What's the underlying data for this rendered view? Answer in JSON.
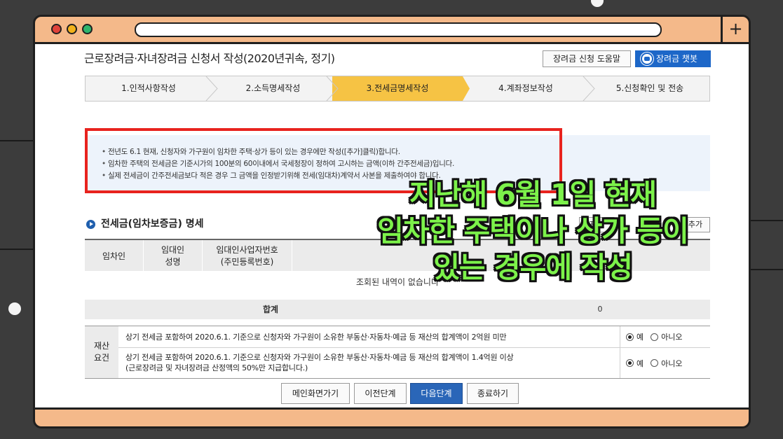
{
  "browser": {
    "new_tab_symbol": "+"
  },
  "page": {
    "title": "근로장려금·자녀장려금 신청서 작성(2020년귀속, 정기)",
    "help_button": "장려금 신청 도움말",
    "chatbot_button": "장려금 챗봇"
  },
  "steps": [
    {
      "label": "1.인적사항작성",
      "active": false
    },
    {
      "label": "2.소득명세작성",
      "active": false
    },
    {
      "label": "3.전세금명세작성",
      "active": true
    },
    {
      "label": "4.계좌정보작성",
      "active": false
    },
    {
      "label": "5.신청확인 및 전송",
      "active": false
    }
  ],
  "notice": [
    "전년도 6.1 현재, 신청자와 가구원이 임차한 주택·상가 등이 있는 경우에만 작성([추가]클릭)합니다.",
    "임차한 주택의 전세금은 기준시가의 100분의 60이내에서 국세청장이 정하여 고시하는 금액(이하 간주전세금)입니다.",
    "실제 전세금이 간주전세금보다 적은 경우 그 금액을 인정받기위해 전세(임대차)계약서 사본을 제출하여야 합니다."
  ],
  "section": {
    "title": "전세금(임차보증금) 명세",
    "btn_partial": "자료",
    "btn_add": "추가"
  },
  "table": {
    "headers": [
      "임차인",
      "임대인\n성명",
      "임대인사업자번호\n(주민등록번호)"
    ],
    "empty_message": "조회된 내역이 없습니다",
    "total_label": "합계",
    "total_value": "0"
  },
  "property": {
    "label": "재산\n요건",
    "rows": [
      {
        "text": "상기 전세금 포함하여 2020.6.1. 기준으로 신청자와 가구원이 소유한 부동산·자동차·예금 등 재산의 합계액이 2억원 미만",
        "selected": "yes"
      },
      {
        "text": "상기 전세금 포함하여 2020.6.1. 기준으로 신청자와 가구원이 소유한 부동산·자동차·예금 등 재산의 합계액이 1.4억원 이상\n(근로장려금 및 자녀장려금 산정액의 50%만 지급합니다.)",
        "selected": "yes"
      }
    ],
    "yes_label": "예",
    "no_label": "아니오"
  },
  "buttons": {
    "main": "메인화면가기",
    "prev": "이전단계",
    "next": "다음단계",
    "end": "종료하기"
  },
  "overlay": {
    "line1": "지난해 6월 1일 현재",
    "line2": "임차한 주택이나 상가 등이",
    "line3": "있는 경우에 작성"
  },
  "colors": {
    "accent_step": "#f6c344",
    "primary_button": "#2a66b8",
    "notice_border": "#e8231e",
    "overlay_text": "#7cf24a",
    "window_frame": "#f4b98a"
  }
}
